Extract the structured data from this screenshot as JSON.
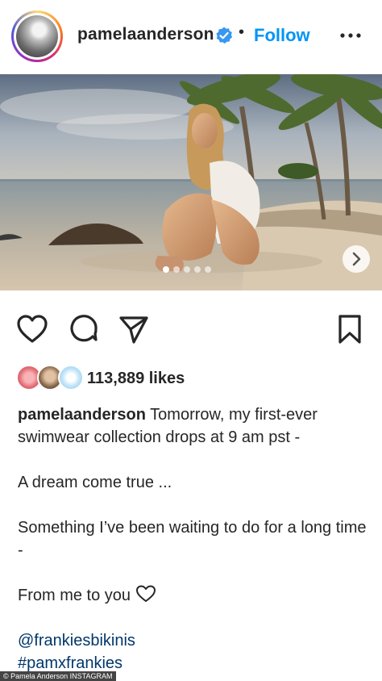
{
  "header": {
    "username": "pamelaanderson",
    "separator": "•",
    "follow_label": "Follow",
    "verified_icon": "verified-badge-icon",
    "more_icon": "more-options-icon",
    "accent_color": "#0095f6"
  },
  "post": {
    "carousel": {
      "total_slides": 5,
      "active_slide": 1
    },
    "next_icon": "chevron-right-icon"
  },
  "actions": {
    "like_icon": "heart-icon",
    "comment_icon": "comment-icon",
    "share_icon": "send-icon",
    "save_icon": "bookmark-icon"
  },
  "likes": {
    "count_text": "113,889 likes"
  },
  "caption": {
    "username": "pamelaanderson",
    "line1": "Tomorrow, my first-ever swimwear collection drops at 9 am pst -",
    "line2": "A dream come true ...",
    "line3": "Something I’ve been waiting to do for a long time -",
    "line4": "From me to you",
    "mention": "@frankiesbikinis",
    "hashtag": "#pamxfrankies"
  },
  "credit": {
    "text": "© Pamela Anderson INSTAGRAM"
  }
}
